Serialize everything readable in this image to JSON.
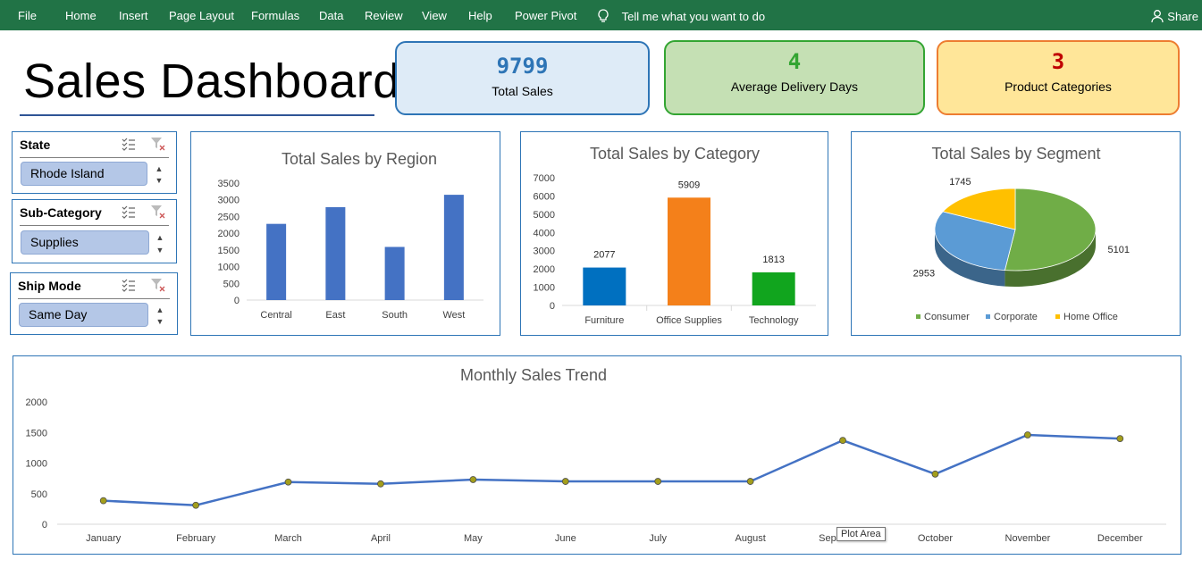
{
  "ribbon": {
    "tabs": [
      "File",
      "Home",
      "Insert",
      "Page Layout",
      "Formulas",
      "Data",
      "Review",
      "View",
      "Help",
      "Power Pivot"
    ],
    "tell_me": "Tell me what you want to do",
    "share": "Share",
    "color": "#217346"
  },
  "dashboard": {
    "title": "Sales Dashboard"
  },
  "kpis": {
    "total_sales": {
      "value": "9799",
      "label": "Total Sales",
      "color": "#2e75b6",
      "bg": "#deebf7"
    },
    "avg_delivery": {
      "value": "4",
      "label": "Average Delivery Days",
      "color": "#33a532",
      "bg": "#c5e0b4"
    },
    "categories": {
      "value": "3",
      "label": "Product Categories",
      "color": "#c00000",
      "bg": "#ffe699",
      "border": "#ed7d31"
    }
  },
  "slicers": {
    "state": {
      "header": "State",
      "selected": "Rhode Island"
    },
    "sub_category": {
      "header": "Sub-Category",
      "selected": "Supplies"
    },
    "ship_mode": {
      "header": "Ship Mode",
      "selected": "Same Day"
    }
  },
  "tooltip": "Plot Area",
  "chart_data": [
    {
      "type": "bar",
      "title": "Total Sales by Region",
      "categories": [
        "Central",
        "East",
        "South",
        "West"
      ],
      "values": [
        2280,
        2780,
        1590,
        3150
      ],
      "ylim": [
        0,
        3500
      ],
      "yticks": [
        0,
        500,
        1000,
        1500,
        2000,
        2500,
        3000,
        3500
      ],
      "color": "#4472c4",
      "grid": false
    },
    {
      "type": "bar",
      "title": "Total Sales by Category",
      "categories": [
        "Furniture",
        "Office Supplies",
        "Technology"
      ],
      "values": [
        2077,
        5909,
        1813
      ],
      "ylim": [
        0,
        7000
      ],
      "yticks": [
        0,
        1000,
        2000,
        3000,
        4000,
        5000,
        6000,
        7000
      ],
      "colors": [
        "#0070c0",
        "#f4801a",
        "#11a51e"
      ],
      "data_labels": true,
      "grid": false
    },
    {
      "type": "pie",
      "title": "Total Sales by Segment",
      "categories": [
        "Consumer",
        "Corporate",
        "Home Office"
      ],
      "values": [
        5101,
        2953,
        1745
      ],
      "colors": [
        "#70ad47",
        "#5b9bd5",
        "#ffc000"
      ],
      "data_labels": true,
      "legend": "bottom"
    },
    {
      "type": "line",
      "title": "Monthly Sales Trend",
      "categories": [
        "January",
        "February",
        "March",
        "April",
        "May",
        "June",
        "July",
        "August",
        "September",
        "October",
        "November",
        "December"
      ],
      "values": [
        385,
        310,
        690,
        660,
        730,
        700,
        700,
        700,
        1370,
        820,
        1460,
        1400
      ],
      "ylim": [
        0,
        2000
      ],
      "yticks": [
        0,
        500,
        1000,
        1500,
        2000
      ],
      "color": "#4472c4",
      "marker_color": "#a39e1c",
      "grid": false
    }
  ]
}
